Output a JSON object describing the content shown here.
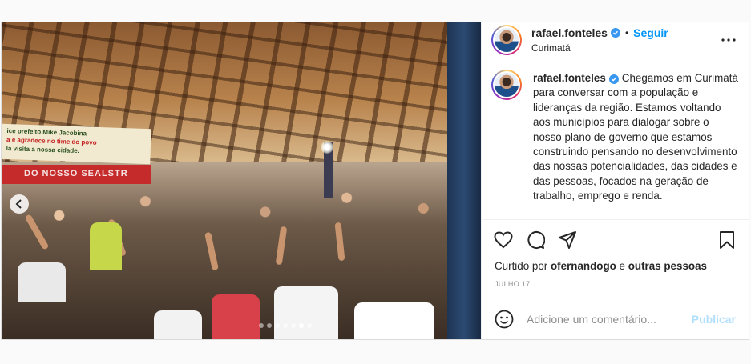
{
  "post": {
    "photo_banner_line1": "ice prefeito Mike Jacobina",
    "photo_banner_line2": "a e agradece no time do povo",
    "photo_banner_line3": "la visita a nossa cidade.",
    "photo_banner_red": "DO  NOSSO  SEALSTR",
    "carousel": {
      "total": 7,
      "active": 6
    }
  },
  "header": {
    "username": "rafael.fonteles",
    "separator": "•",
    "follow_label": "Seguir",
    "location": "Curimatá"
  },
  "caption": {
    "username": "rafael.fonteles",
    "text": "Chegamos em Curimatá para conversar com a população e lideranças da região. Estamos voltando aos municípios para dialogar sobre o nosso plano de governo que estamos construindo pensando no desenvolvimento das nossas potencialidades, das cidades e das pessoas, focados na geração de trabalho, emprego e renda."
  },
  "likes": {
    "prefix": "Curtido por",
    "user": "ofernandogo",
    "connector": "e",
    "others": "outras pessoas"
  },
  "date": "JULHO 17",
  "comment": {
    "placeholder": "Adicione um comentário...",
    "publish_label": "Publicar"
  },
  "colors": {
    "accent": "#0095f6",
    "verified": "#3897f0",
    "publish_disabled": "#b2dffc"
  },
  "icons": [
    "chevron-left-icon",
    "verified-icon",
    "more-icon",
    "heart-icon",
    "comment-icon",
    "share-icon",
    "bookmark-icon",
    "emoji-icon"
  ]
}
